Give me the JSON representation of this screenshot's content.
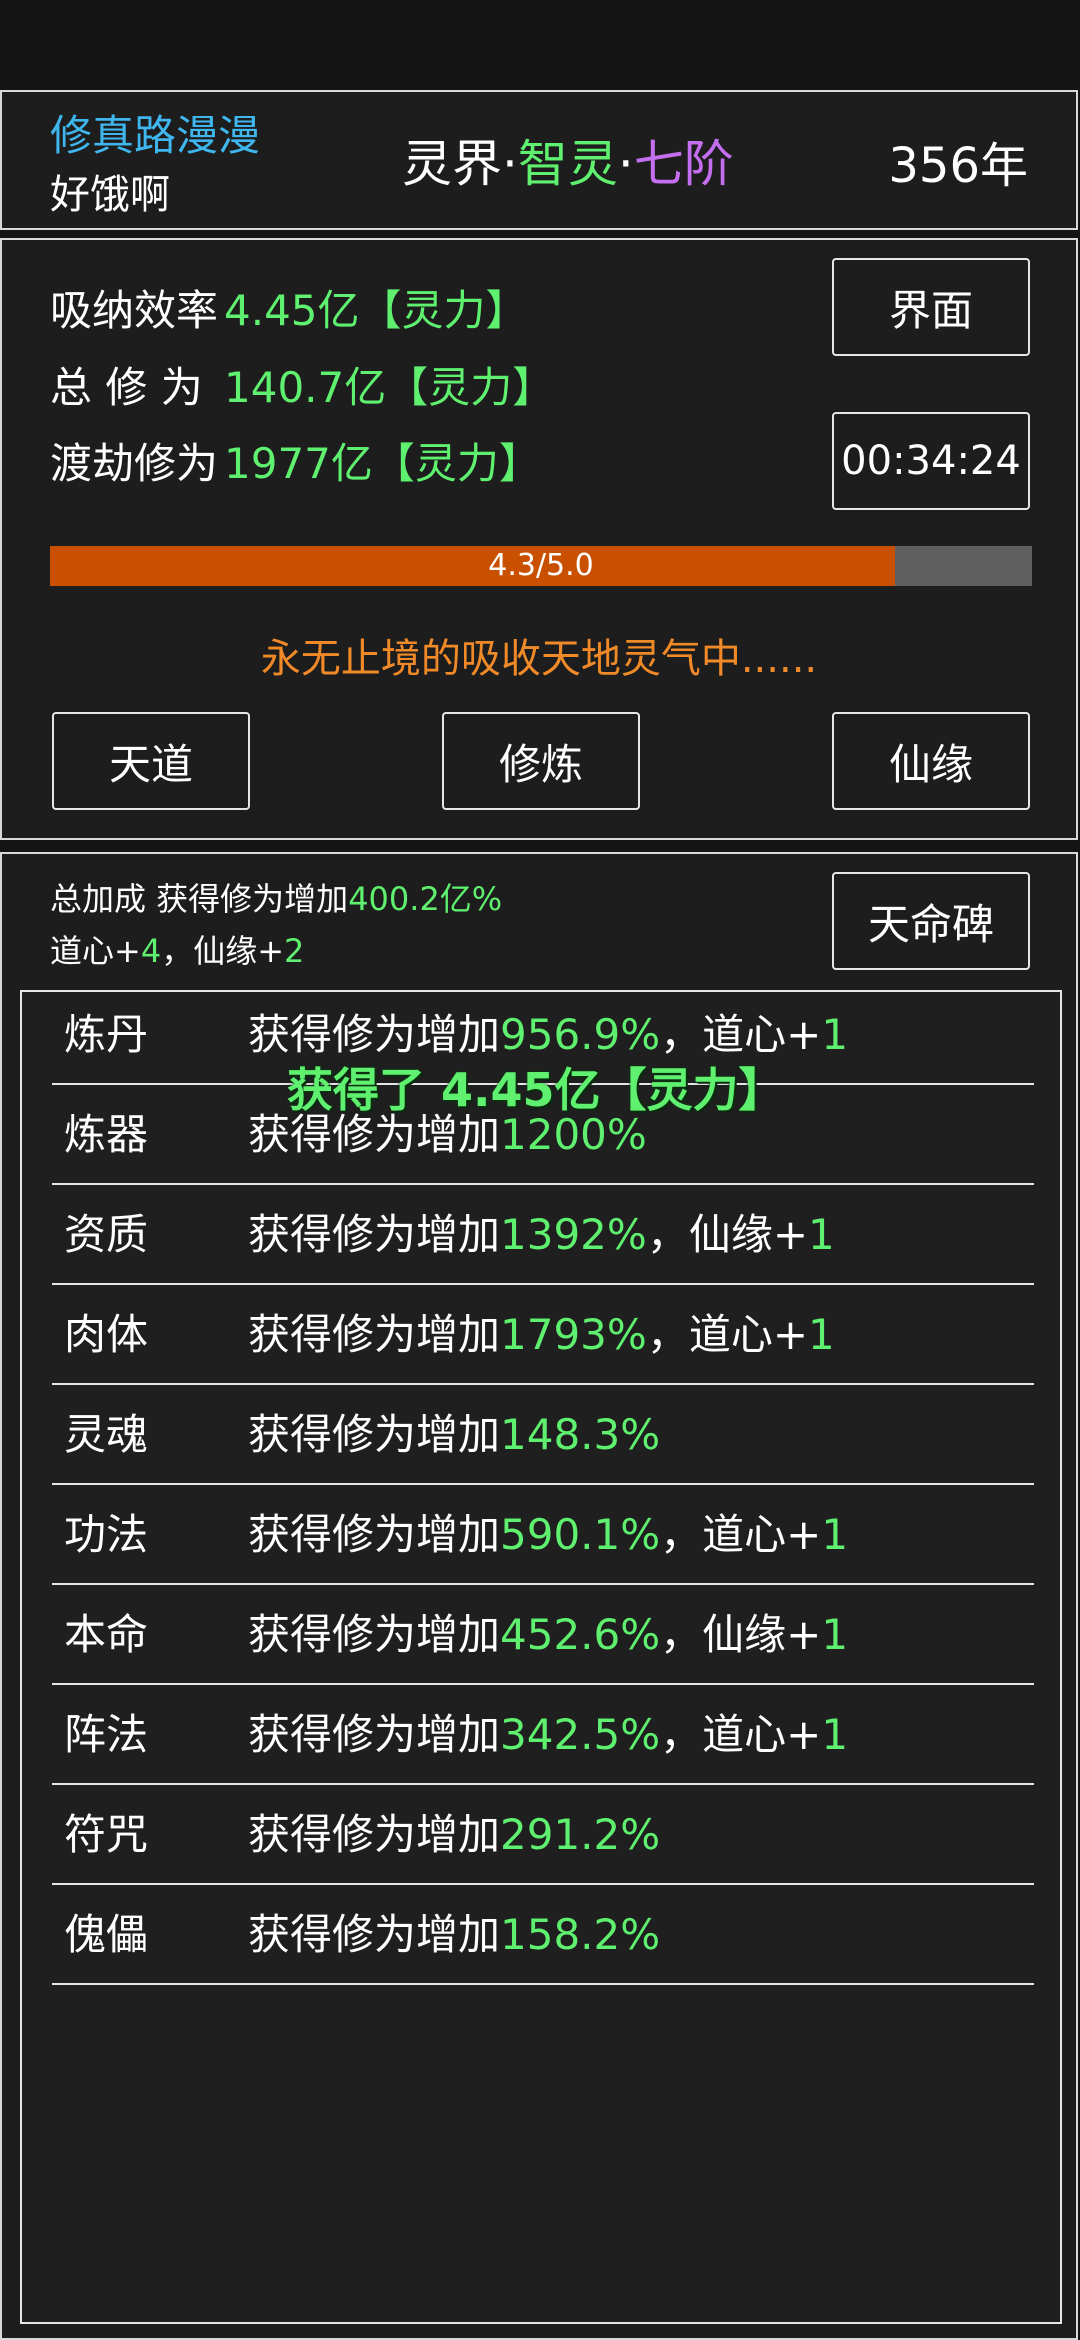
{
  "header": {
    "game_title": "修真路漫漫",
    "player_name": "好饿啊",
    "realm_prefix": "灵界",
    "realm_sep1": "·",
    "realm_stage": "智灵",
    "realm_sep2": "·",
    "realm_level": "七阶",
    "years": "356年"
  },
  "stats": {
    "absorb_label": "吸纳效率",
    "absorb_value": "4.45亿【灵力】",
    "total_label": "总 修 为",
    "total_value": "140.7亿【灵力】",
    "tribulation_label": "渡劫修为",
    "tribulation_value": "1977亿【灵力】",
    "interface_button": "界面",
    "timer": "00:34:24",
    "progress_text": "4.3/5.0",
    "progress_fraction": 0.86,
    "status_message": "永无止境的吸收天地灵气中......"
  },
  "actions": {
    "tiandao": "天道",
    "cultivate": "修炼",
    "xianyuan": "仙缘"
  },
  "bonus": {
    "line1_prefix": "总加成 获得修为增加",
    "line1_value": "400.2亿%",
    "daoxin_label": "道心+",
    "daoxin_value": "4",
    "sep": "，",
    "xianyuan_label": "仙缘+",
    "xianyuan_value": "2",
    "stele_button": "天命碑"
  },
  "float_text": "获得了 4.45亿【灵力】",
  "skills": [
    {
      "name": "炼丹",
      "prefix": "获得修为增加",
      "value": "956.9%",
      "extra_label": "，道心+",
      "extra_value": "1"
    },
    {
      "name": "炼器",
      "prefix": "获得修为增加",
      "value": "1200%",
      "extra_label": "",
      "extra_value": ""
    },
    {
      "name": "资质",
      "prefix": "获得修为增加",
      "value": "1392%",
      "extra_label": "，仙缘+",
      "extra_value": "1"
    },
    {
      "name": "肉体",
      "prefix": "获得修为增加",
      "value": "1793%",
      "extra_label": "，道心+",
      "extra_value": "1"
    },
    {
      "name": "灵魂",
      "prefix": "获得修为增加",
      "value": "148.3%",
      "extra_label": "",
      "extra_value": ""
    },
    {
      "name": "功法",
      "prefix": "获得修为增加",
      "value": "590.1%",
      "extra_label": "，道心+",
      "extra_value": "1"
    },
    {
      "name": "本命",
      "prefix": "获得修为增加",
      "value": "452.6%",
      "extra_label": "，仙缘+",
      "extra_value": "1"
    },
    {
      "name": "阵法",
      "prefix": "获得修为增加",
      "value": "342.5%",
      "extra_label": "，道心+",
      "extra_value": "1"
    },
    {
      "name": "符咒",
      "prefix": "获得修为增加",
      "value": "291.2%",
      "extra_label": "",
      "extra_value": ""
    },
    {
      "name": "傀儡",
      "prefix": "获得修为增加",
      "value": "158.2%",
      "extra_label": "",
      "extra_value": ""
    }
  ],
  "colors": {
    "green": "#5ef06e",
    "purple": "#c46ef0",
    "cyan": "#3fb6ee",
    "orange": "#f08a28",
    "progress_fill": "#c85000",
    "progress_track": "#5f5f5f"
  }
}
